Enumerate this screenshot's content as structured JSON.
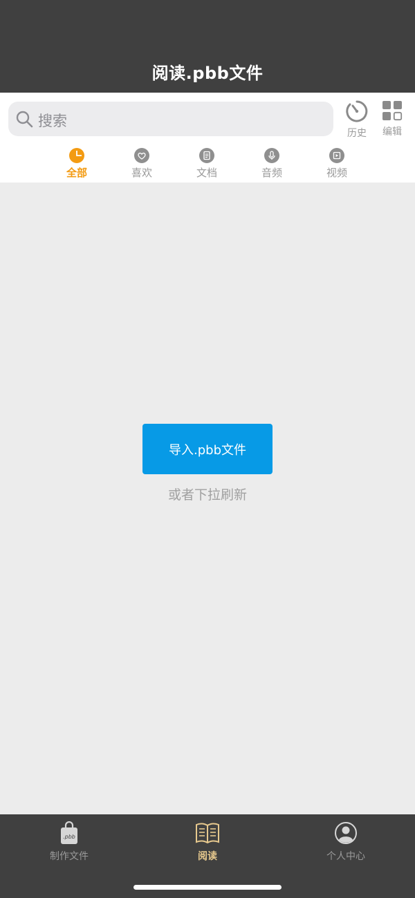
{
  "nav": {
    "title": "阅读.pbb文件"
  },
  "search": {
    "placeholder": "搜索"
  },
  "toolbar": {
    "history_label": "历史",
    "edit_label": "编辑"
  },
  "tabs": [
    {
      "label": "全部",
      "icon": "pie-chart-icon",
      "active": true
    },
    {
      "label": "喜欢",
      "icon": "heart-icon",
      "active": false
    },
    {
      "label": "文档",
      "icon": "document-icon",
      "active": false
    },
    {
      "label": "音频",
      "icon": "microphone-icon",
      "active": false
    },
    {
      "label": "视频",
      "icon": "video-icon",
      "active": false
    }
  ],
  "main": {
    "import_button_label": "导入.pbb文件",
    "hint": "或者下拉刷新"
  },
  "tabbar": {
    "items": [
      {
        "label": "制作文件",
        "icon": "pbb-bag-icon",
        "badge_text": ".pbb",
        "active": false
      },
      {
        "label": "阅读",
        "icon": "open-book-icon",
        "active": true
      },
      {
        "label": "个人中心",
        "icon": "user-avatar-icon",
        "active": false
      }
    ]
  },
  "colors": {
    "nav_background": "#404040",
    "accent_orange": "#f39b12",
    "button_blue": "#079ae6",
    "tabbar_active": "#e7c98e",
    "inactive_gray": "#9a9a9a"
  }
}
